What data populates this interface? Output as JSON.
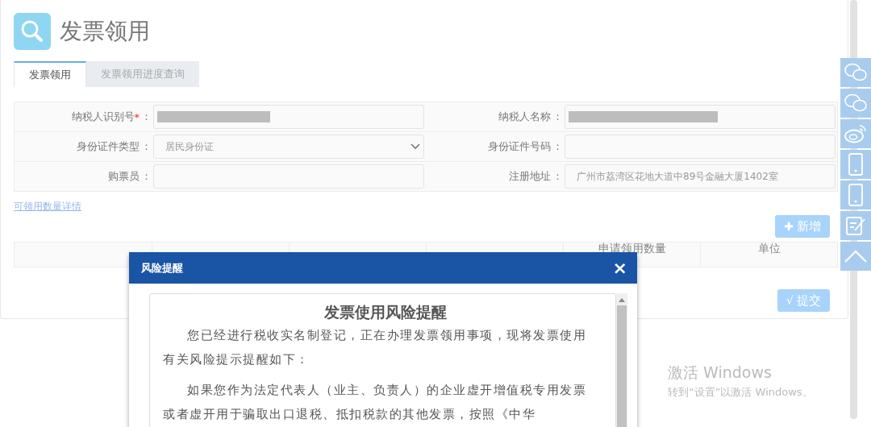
{
  "page": {
    "title": "发票领用"
  },
  "tabs": [
    {
      "label": "发票领用",
      "selected": true
    },
    {
      "label": "发票领用进度查询",
      "selected": false
    }
  ],
  "form": {
    "rows": [
      [
        {
          "label": "纳税人识别号",
          "required": true,
          "kind": "redacted"
        },
        {
          "label": "纳税人名称",
          "required": false,
          "kind": "redacted"
        }
      ],
      [
        {
          "label": "身份证件类型",
          "required": false,
          "kind": "select",
          "value": "居民身份证"
        },
        {
          "label": "身份证件号码",
          "required": false,
          "kind": "text"
        }
      ],
      [
        {
          "label": "购票员",
          "required": false,
          "kind": "text"
        },
        {
          "label": "注册地址",
          "required": false,
          "kind": "text",
          "value": "广州市荔湾区花地大道中89号金融大厦1402室"
        }
      ]
    ],
    "colon": "：",
    "required_mark": "*"
  },
  "quota_link": "可领用数量详情",
  "add_button": {
    "icon": "✚",
    "label": "新增"
  },
  "table": {
    "columns": [
      null,
      null,
      null,
      null,
      "申请领用数量",
      "单位"
    ]
  },
  "submit_button": {
    "icon": "√",
    "label": "提交"
  },
  "side_toolbar": [
    {
      "kind": "chat"
    },
    {
      "kind": "chat"
    },
    {
      "kind": "weibo"
    },
    {
      "kind": "phone"
    },
    {
      "kind": "phone"
    },
    {
      "kind": "edit"
    },
    {
      "kind": "top"
    }
  ],
  "dialog": {
    "title": "风险提醒",
    "close": "×",
    "heading": "发票使用风险提醒",
    "paragraphs": [
      "您已经进行税收实名制登记，正在办理发票领用事项，现将发票使用有关风险提示提醒如下：",
      "如果您作为法定代表人（业主、负责人）的企业虚开增值税专用发票或者虚开用于骗取出口退税、抵扣税款的其他发票，按照《中华"
    ]
  },
  "activation": {
    "title": "激活 Windows",
    "subtitle": "转到“设置”以激活 Windows。"
  }
}
